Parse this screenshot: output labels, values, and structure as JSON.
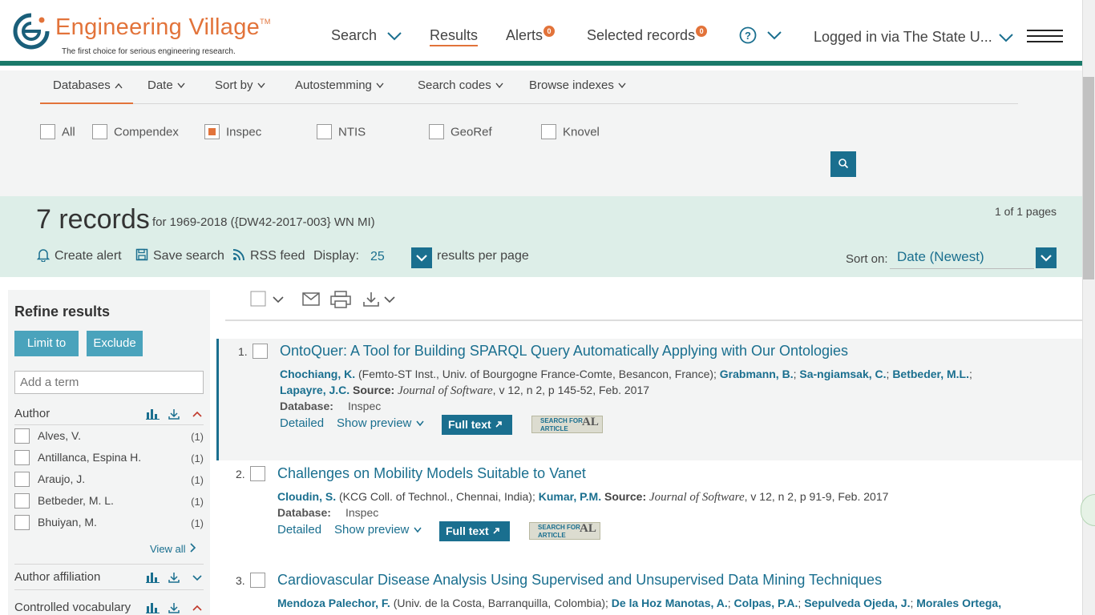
{
  "header": {
    "logo_title": "Engineering Village",
    "logo_tm": "TM",
    "tagline": "The first choice for serious engineering research.",
    "nav": {
      "search": "Search",
      "results": "Results",
      "alerts": "Alerts",
      "alerts_count": "0",
      "selected": "Selected records",
      "selected_count": "0",
      "login": "Logged in via The State U..."
    }
  },
  "options": {
    "tabs": [
      "Databases",
      "Date",
      "Sort by",
      "Autostemming",
      "Search codes",
      "Browse indexes"
    ],
    "databases": [
      {
        "label": "All",
        "checked": false
      },
      {
        "label": "Compendex",
        "checked": false
      },
      {
        "label": "Inspec",
        "checked": true
      },
      {
        "label": "NTIS",
        "checked": false
      },
      {
        "label": "GeoRef",
        "checked": false
      },
      {
        "label": "Knovel",
        "checked": false
      }
    ]
  },
  "records": {
    "count": "7 records",
    "query": "for 1969-2018 ({DW42-2017-003} WN MI)",
    "pages": "1 of 1 pages",
    "create_alert": "Create alert",
    "save_search": "Save search",
    "rss": "RSS feed",
    "display_label": "Display:",
    "display_value": "25",
    "per_page": "results per page",
    "sort_label": "Sort on:",
    "sort_value": "Date (Newest)"
  },
  "sidebar": {
    "title": "Refine results",
    "limit_to": "Limit to",
    "exclude": "Exclude",
    "add_term_placeholder": "Add a term",
    "author_head": "Author",
    "authors": [
      {
        "name": "Alves, V.",
        "count": "(1)"
      },
      {
        "name": "Antillanca, Espina H.",
        "count": "(1)"
      },
      {
        "name": "Araujo, J.",
        "count": "(1)"
      },
      {
        "name": "Betbeder, M. L.",
        "count": "(1)"
      },
      {
        "name": "Bhuiyan, M.",
        "count": "(1)"
      }
    ],
    "view_all": "View all",
    "affiliation_head": "Author affiliation",
    "vocab_head": "Controlled vocabulary"
  },
  "results": [
    {
      "num": "1.",
      "title": "OntoQuer: A Tool for Building SPARQL Query Automatically Applying with Our Ontologies",
      "a1": "Chochiang, K.",
      "aff1": " (Femto-ST Inst., Univ. of Bourgogne France-Comte, Besancon, France); ",
      "a2": "Grabmann, B.",
      "sep1": "; ",
      "a3": "Sa-ngiamsak, C.",
      "sep2": "; ",
      "a4": "Betbeder, M.L.",
      "sep3": ";",
      "a5": "Lapayre, J.C.",
      "source_label": " Source: ",
      "journal": "Journal of Software",
      "source_rest": ", v 12, n 2, p 145-52, Feb. 2017",
      "db_label": "Database:",
      "db_value": "Inspec",
      "detailed": "Detailed",
      "preview": "Show preview",
      "fulltext": "Full text"
    },
    {
      "num": "2.",
      "title": "Challenges on Mobility Models Suitable to Vanet",
      "a1": "Cloudin, S.",
      "aff1": " (KCG Coll. of Technol., Chennai, India); ",
      "a2": "Kumar, P.M.",
      "source_label": " Source: ",
      "journal": "Journal of Software",
      "source_rest": ", v 12, n 2, p 91-9, Feb. 2017",
      "db_label": "Database:",
      "db_value": "Inspec",
      "detailed": "Detailed",
      "preview": "Show preview",
      "fulltext": "Full text"
    },
    {
      "num": "3.",
      "title": "Cardiovascular Disease Analysis Using Supervised and Unsupervised Data Mining Techniques",
      "a1": "Mendoza Palechor, F.",
      "aff1": " (Univ. de la Costa, Barranquilla, Colombia); ",
      "a2": "De la Hoz Manotas, A.",
      "sep1": "; ",
      "a3": "Colpas, P.A.",
      "sep2": "; ",
      "a4": "Sepulveda Ojeda, J.",
      "sep3": "; ",
      "a5": "Morales Ortega,"
    }
  ],
  "sfa": {
    "line1": "SEARCH FOR",
    "line2": "ARTICLE",
    "al": "AL"
  },
  "colors": {
    "brand_orange": "#e2733a",
    "brand_teal": "#1a7a6a",
    "link_blue": "#1a6f8f",
    "button_blue": "#4aa3bc"
  }
}
